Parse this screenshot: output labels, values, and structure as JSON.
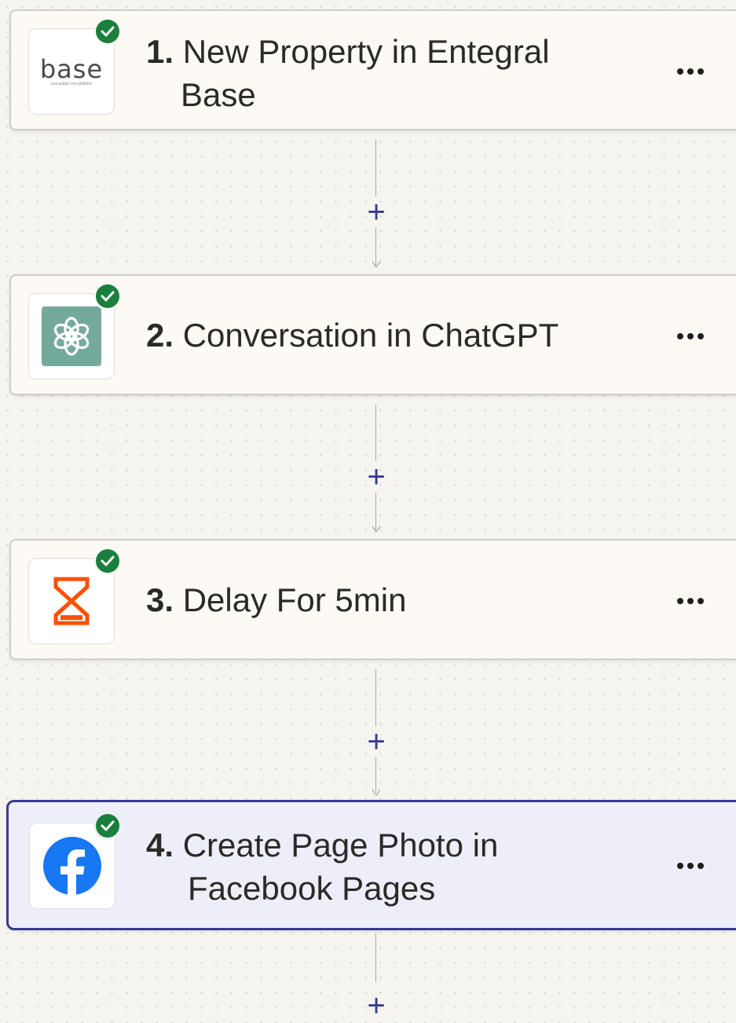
{
  "steps": [
    {
      "number": "1.",
      "title_line1": "New Property in Entegral",
      "title_line2": "Base",
      "app": "Entegral Base",
      "logo_text": "base",
      "logo_subtext": "real estate crm platform",
      "icon": "base-logo-icon",
      "status": "check-icon"
    },
    {
      "number": "2.",
      "title_line1": "Conversation in ChatGPT",
      "app": "ChatGPT",
      "icon": "chatgpt-logo-icon",
      "icon_bg": "#74aa9c",
      "status": "check-icon"
    },
    {
      "number": "3.",
      "title_line1": "Delay For 5min",
      "app": "Delay",
      "icon": "hourglass-icon",
      "icon_color": "#ff4f00",
      "status": "check-icon"
    },
    {
      "number": "4.",
      "title_line1": "Create Page Photo in",
      "title_line2": "Facebook Pages",
      "app": "Facebook Pages",
      "icon": "facebook-logo-icon",
      "icon_color": "#1877f2",
      "status": "check-icon",
      "selected": true
    }
  ],
  "add_step_symbol": "+",
  "colors": {
    "accent": "#3b3a8f",
    "success": "#1a7f3c",
    "canvas": "#f5f4ef",
    "card": "#fdfaf5"
  }
}
